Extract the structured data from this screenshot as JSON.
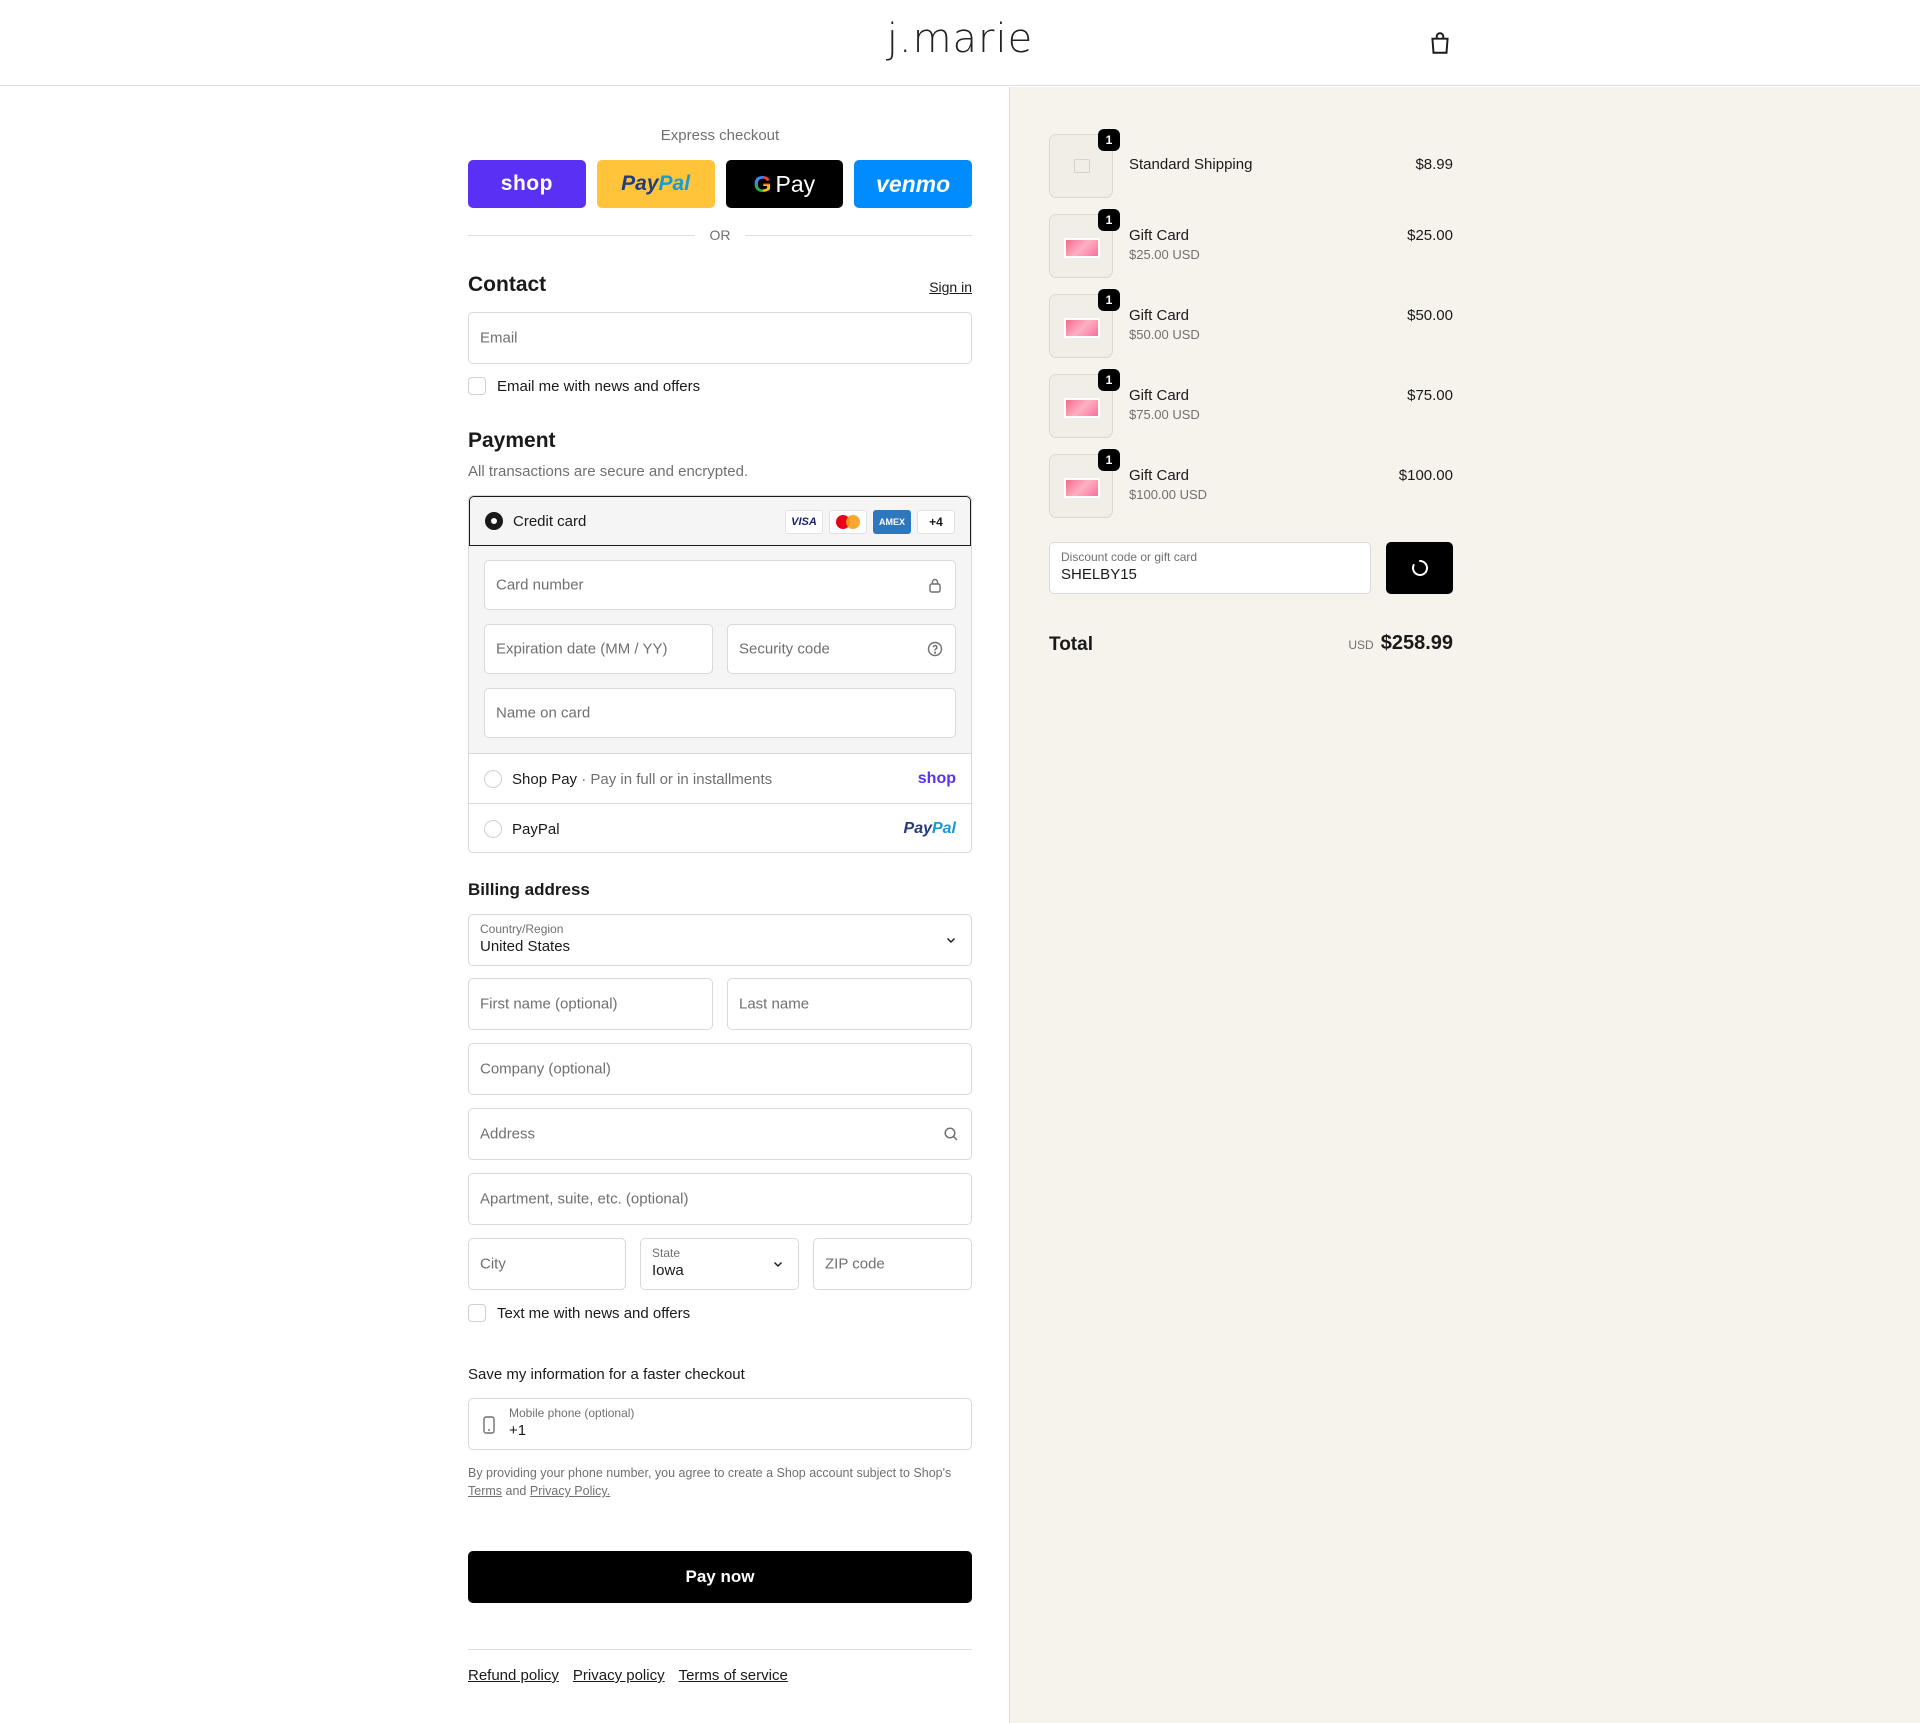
{
  "header": {
    "logo": "j.marie",
    "cart_icon": "bag-icon"
  },
  "express": {
    "title": "Express checkout",
    "buttons": {
      "shop": "shop",
      "paypal_pay": "Pay",
      "paypal_pal": "Pal",
      "gpay_g": "G",
      "gpay": "Pay",
      "venmo": "venmo"
    },
    "or": "OR"
  },
  "contact": {
    "heading": "Contact",
    "signin": "Sign in",
    "email_placeholder": "Email",
    "news_label": "Email me with news and offers"
  },
  "payment": {
    "heading": "Payment",
    "subtitle": "All transactions are secure and encrypted.",
    "credit_card": {
      "label": "Credit card",
      "badges": {
        "visa": "VISA",
        "amex": "AMEX",
        "more": "+4"
      },
      "card_number": "Card number",
      "expiration": "Expiration date (MM / YY)",
      "security": "Security code",
      "name_on_card": "Name on card"
    },
    "shop_pay": {
      "label": "Shop Pay",
      "sub": "Pay in full or in installments",
      "brand": "shop"
    },
    "paypal": {
      "label": "PayPal",
      "brand_pay": "Pay",
      "brand_pal": "Pal"
    }
  },
  "billing": {
    "heading": "Billing address",
    "country_label": "Country/Region",
    "country_value": "United States",
    "first_name": "First name (optional)",
    "last_name": "Last name",
    "company": "Company (optional)",
    "address": "Address",
    "apartment": "Apartment, suite, etc. (optional)",
    "city": "City",
    "state_label": "State",
    "state_value": "Iowa",
    "zip": "ZIP code",
    "text_label": "Text me with news and offers"
  },
  "save": {
    "heading": "Save my information for a faster checkout",
    "phone_label": "Mobile phone (optional)",
    "phone_value": "+1",
    "legal_prefix": "By providing your phone number, you agree to create a Shop account subject to Shop's",
    "legal_terms": "Terms",
    "legal_and": "and",
    "legal_privacy": "Privacy Policy."
  },
  "pay_now": "Pay now",
  "footer": {
    "refund": "Refund policy",
    "privacy": "Privacy policy",
    "terms": "Terms of service"
  },
  "summary": {
    "items": [
      {
        "qty": "1",
        "name": "Standard Shipping",
        "sub": "",
        "price": "$8.99"
      },
      {
        "qty": "1",
        "name": "Gift Card",
        "sub": "$25.00 USD",
        "price": "$25.00"
      },
      {
        "qty": "1",
        "name": "Gift Card",
        "sub": "$50.00 USD",
        "price": "$50.00"
      },
      {
        "qty": "1",
        "name": "Gift Card",
        "sub": "$75.00 USD",
        "price": "$75.00"
      },
      {
        "qty": "1",
        "name": "Gift Card",
        "sub": "$100.00 USD",
        "price": "$100.00"
      }
    ],
    "discount_label": "Discount code or gift card",
    "discount_value": "SHELBY15",
    "total_label": "Total",
    "currency": "USD",
    "total": "$258.99"
  },
  "colors": {
    "accent": "#000000",
    "summary_bg": "#f5f3ec",
    "shop_purple": "#5a31f4",
    "paypal_yellow": "#ffc439",
    "venmo_blue": "#008cff"
  }
}
